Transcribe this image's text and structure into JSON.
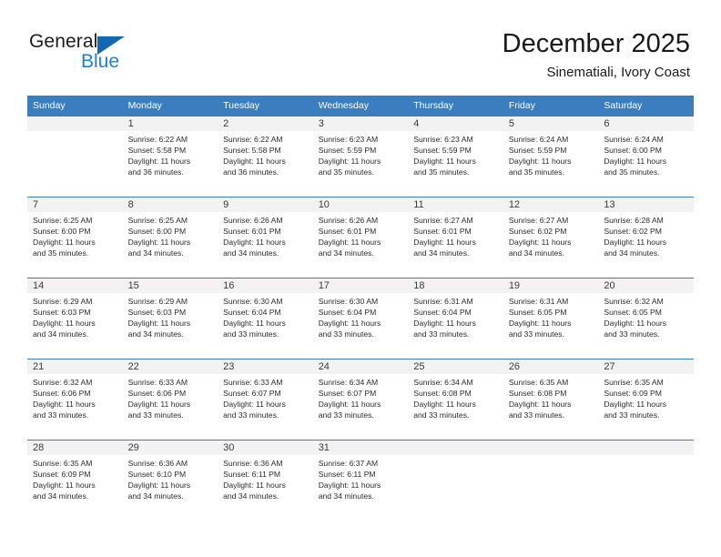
{
  "brand": {
    "name_part1": "General",
    "name_part2": "Blue",
    "logo_icon": "triangle-logo-icon"
  },
  "header": {
    "month_title": "December 2025",
    "location": "Sinematiali, Ivory Coast"
  },
  "colors": {
    "header_blue": "#3a7ebf",
    "brand_dark": "#1c1c1c",
    "brand_blue": "#1b7fd4",
    "daynum_background": "#f2f2f2",
    "text": "#2b2b2b"
  },
  "calendar": {
    "weekday_headers": [
      "Sunday",
      "Monday",
      "Tuesday",
      "Wednesday",
      "Thursday",
      "Friday",
      "Saturday"
    ],
    "weeks": [
      [
        {
          "day": "",
          "empty": true,
          "sunrise": "",
          "sunset": "",
          "daylight_line1": "",
          "daylight_line2": ""
        },
        {
          "day": "1",
          "empty": false,
          "sunrise": "Sunrise: 6:22 AM",
          "sunset": "Sunset: 5:58 PM",
          "daylight_line1": "Daylight: 11 hours",
          "daylight_line2": "and 36 minutes."
        },
        {
          "day": "2",
          "empty": false,
          "sunrise": "Sunrise: 6:22 AM",
          "sunset": "Sunset: 5:58 PM",
          "daylight_line1": "Daylight: 11 hours",
          "daylight_line2": "and 36 minutes."
        },
        {
          "day": "3",
          "empty": false,
          "sunrise": "Sunrise: 6:23 AM",
          "sunset": "Sunset: 5:59 PM",
          "daylight_line1": "Daylight: 11 hours",
          "daylight_line2": "and 35 minutes."
        },
        {
          "day": "4",
          "empty": false,
          "sunrise": "Sunrise: 6:23 AM",
          "sunset": "Sunset: 5:59 PM",
          "daylight_line1": "Daylight: 11 hours",
          "daylight_line2": "and 35 minutes."
        },
        {
          "day": "5",
          "empty": false,
          "sunrise": "Sunrise: 6:24 AM",
          "sunset": "Sunset: 5:59 PM",
          "daylight_line1": "Daylight: 11 hours",
          "daylight_line2": "and 35 minutes."
        },
        {
          "day": "6",
          "empty": false,
          "sunrise": "Sunrise: 6:24 AM",
          "sunset": "Sunset: 6:00 PM",
          "daylight_line1": "Daylight: 11 hours",
          "daylight_line2": "and 35 minutes."
        }
      ],
      [
        {
          "day": "7",
          "empty": false,
          "sunrise": "Sunrise: 6:25 AM",
          "sunset": "Sunset: 6:00 PM",
          "daylight_line1": "Daylight: 11 hours",
          "daylight_line2": "and 35 minutes."
        },
        {
          "day": "8",
          "empty": false,
          "sunrise": "Sunrise: 6:25 AM",
          "sunset": "Sunset: 6:00 PM",
          "daylight_line1": "Daylight: 11 hours",
          "daylight_line2": "and 34 minutes."
        },
        {
          "day": "9",
          "empty": false,
          "sunrise": "Sunrise: 6:26 AM",
          "sunset": "Sunset: 6:01 PM",
          "daylight_line1": "Daylight: 11 hours",
          "daylight_line2": "and 34 minutes."
        },
        {
          "day": "10",
          "empty": false,
          "sunrise": "Sunrise: 6:26 AM",
          "sunset": "Sunset: 6:01 PM",
          "daylight_line1": "Daylight: 11 hours",
          "daylight_line2": "and 34 minutes."
        },
        {
          "day": "11",
          "empty": false,
          "sunrise": "Sunrise: 6:27 AM",
          "sunset": "Sunset: 6:01 PM",
          "daylight_line1": "Daylight: 11 hours",
          "daylight_line2": "and 34 minutes."
        },
        {
          "day": "12",
          "empty": false,
          "sunrise": "Sunrise: 6:27 AM",
          "sunset": "Sunset: 6:02 PM",
          "daylight_line1": "Daylight: 11 hours",
          "daylight_line2": "and 34 minutes."
        },
        {
          "day": "13",
          "empty": false,
          "sunrise": "Sunrise: 6:28 AM",
          "sunset": "Sunset: 6:02 PM",
          "daylight_line1": "Daylight: 11 hours",
          "daylight_line2": "and 34 minutes."
        }
      ],
      [
        {
          "day": "14",
          "empty": false,
          "sunrise": "Sunrise: 6:29 AM",
          "sunset": "Sunset: 6:03 PM",
          "daylight_line1": "Daylight: 11 hours",
          "daylight_line2": "and 34 minutes."
        },
        {
          "day": "15",
          "empty": false,
          "sunrise": "Sunrise: 6:29 AM",
          "sunset": "Sunset: 6:03 PM",
          "daylight_line1": "Daylight: 11 hours",
          "daylight_line2": "and 34 minutes."
        },
        {
          "day": "16",
          "empty": false,
          "sunrise": "Sunrise: 6:30 AM",
          "sunset": "Sunset: 6:04 PM",
          "daylight_line1": "Daylight: 11 hours",
          "daylight_line2": "and 33 minutes."
        },
        {
          "day": "17",
          "empty": false,
          "sunrise": "Sunrise: 6:30 AM",
          "sunset": "Sunset: 6:04 PM",
          "daylight_line1": "Daylight: 11 hours",
          "daylight_line2": "and 33 minutes."
        },
        {
          "day": "18",
          "empty": false,
          "sunrise": "Sunrise: 6:31 AM",
          "sunset": "Sunset: 6:04 PM",
          "daylight_line1": "Daylight: 11 hours",
          "daylight_line2": "and 33 minutes."
        },
        {
          "day": "19",
          "empty": false,
          "sunrise": "Sunrise: 6:31 AM",
          "sunset": "Sunset: 6:05 PM",
          "daylight_line1": "Daylight: 11 hours",
          "daylight_line2": "and 33 minutes."
        },
        {
          "day": "20",
          "empty": false,
          "sunrise": "Sunrise: 6:32 AM",
          "sunset": "Sunset: 6:05 PM",
          "daylight_line1": "Daylight: 11 hours",
          "daylight_line2": "and 33 minutes."
        }
      ],
      [
        {
          "day": "21",
          "empty": false,
          "sunrise": "Sunrise: 6:32 AM",
          "sunset": "Sunset: 6:06 PM",
          "daylight_line1": "Daylight: 11 hours",
          "daylight_line2": "and 33 minutes."
        },
        {
          "day": "22",
          "empty": false,
          "sunrise": "Sunrise: 6:33 AM",
          "sunset": "Sunset: 6:06 PM",
          "daylight_line1": "Daylight: 11 hours",
          "daylight_line2": "and 33 minutes."
        },
        {
          "day": "23",
          "empty": false,
          "sunrise": "Sunrise: 6:33 AM",
          "sunset": "Sunset: 6:07 PM",
          "daylight_line1": "Daylight: 11 hours",
          "daylight_line2": "and 33 minutes."
        },
        {
          "day": "24",
          "empty": false,
          "sunrise": "Sunrise: 6:34 AM",
          "sunset": "Sunset: 6:07 PM",
          "daylight_line1": "Daylight: 11 hours",
          "daylight_line2": "and 33 minutes."
        },
        {
          "day": "25",
          "empty": false,
          "sunrise": "Sunrise: 6:34 AM",
          "sunset": "Sunset: 6:08 PM",
          "daylight_line1": "Daylight: 11 hours",
          "daylight_line2": "and 33 minutes."
        },
        {
          "day": "26",
          "empty": false,
          "sunrise": "Sunrise: 6:35 AM",
          "sunset": "Sunset: 6:08 PM",
          "daylight_line1": "Daylight: 11 hours",
          "daylight_line2": "and 33 minutes."
        },
        {
          "day": "27",
          "empty": false,
          "sunrise": "Sunrise: 6:35 AM",
          "sunset": "Sunset: 6:09 PM",
          "daylight_line1": "Daylight: 11 hours",
          "daylight_line2": "and 33 minutes."
        }
      ],
      [
        {
          "day": "28",
          "empty": false,
          "sunrise": "Sunrise: 6:35 AM",
          "sunset": "Sunset: 6:09 PM",
          "daylight_line1": "Daylight: 11 hours",
          "daylight_line2": "and 34 minutes."
        },
        {
          "day": "29",
          "empty": false,
          "sunrise": "Sunrise: 6:36 AM",
          "sunset": "Sunset: 6:10 PM",
          "daylight_line1": "Daylight: 11 hours",
          "daylight_line2": "and 34 minutes."
        },
        {
          "day": "30",
          "empty": false,
          "sunrise": "Sunrise: 6:36 AM",
          "sunset": "Sunset: 6:11 PM",
          "daylight_line1": "Daylight: 11 hours",
          "daylight_line2": "and 34 minutes."
        },
        {
          "day": "31",
          "empty": false,
          "sunrise": "Sunrise: 6:37 AM",
          "sunset": "Sunset: 6:11 PM",
          "daylight_line1": "Daylight: 11 hours",
          "daylight_line2": "and 34 minutes."
        },
        {
          "day": "",
          "empty": true,
          "sunrise": "",
          "sunset": "",
          "daylight_line1": "",
          "daylight_line2": ""
        },
        {
          "day": "",
          "empty": true,
          "sunrise": "",
          "sunset": "",
          "daylight_line1": "",
          "daylight_line2": ""
        },
        {
          "day": "",
          "empty": true,
          "sunrise": "",
          "sunset": "",
          "daylight_line1": "",
          "daylight_line2": ""
        }
      ]
    ]
  }
}
